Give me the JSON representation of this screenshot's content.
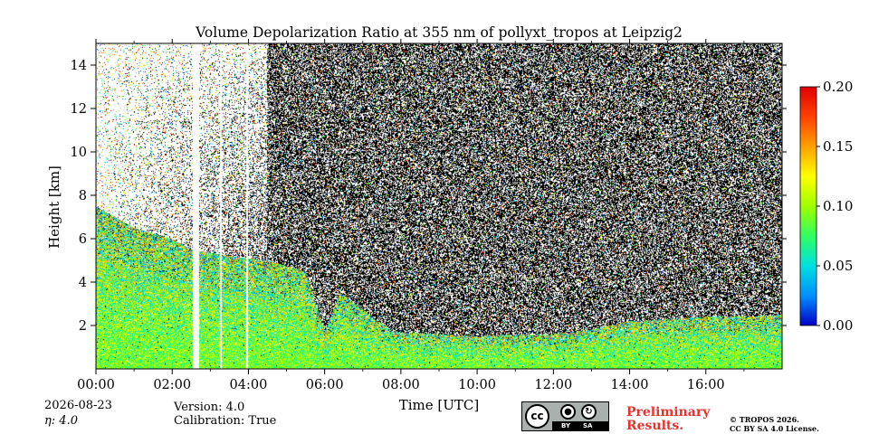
{
  "chart_data": {
    "type": "heatmap",
    "title": "Volume Depolarization Ratio at 355 nm of pollyxt_tropos at Leipzig2",
    "xlabel": "Time [UTC]",
    "ylabel": "Height [km]",
    "xlim": [
      "00:00",
      "18:00"
    ],
    "xlim_hours": [
      0,
      18
    ],
    "ylim": [
      0,
      15
    ],
    "x_ticks": [
      "00:00",
      "02:00",
      "04:00",
      "06:00",
      "08:00",
      "10:00",
      "12:00",
      "14:00",
      "16:00"
    ],
    "y_ticks": [
      2,
      4,
      6,
      8,
      10,
      12,
      14
    ],
    "colorbar": {
      "min": 0.0,
      "max": 0.2,
      "ticks": [
        "0.00",
        "0.05",
        "0.10",
        "0.15",
        "0.20"
      ],
      "colors": [
        "#0000c8",
        "#0090ff",
        "#00e0e0",
        "#30ff60",
        "#a0ff00",
        "#ffff00",
        "#ffa000",
        "#ff4000",
        "#e00000"
      ]
    },
    "features": {
      "near_surface_depolarization": 0.09,
      "boundary_layer_top_km": [
        [
          0.0,
          7.5
        ],
        [
          1.0,
          6.5
        ],
        [
          2.0,
          6.0
        ],
        [
          2.5,
          5.5
        ],
        [
          3.5,
          5.2
        ],
        [
          4.5,
          5.0
        ],
        [
          5.5,
          4.5
        ],
        [
          6.0,
          1.7
        ],
        [
          6.4,
          3.5
        ],
        [
          7.8,
          1.7
        ],
        [
          9.0,
          1.6
        ],
        [
          10.0,
          1.5
        ],
        [
          11.0,
          1.6
        ],
        [
          12.0,
          1.6
        ],
        [
          13.0,
          1.8
        ],
        [
          14.0,
          2.2
        ],
        [
          15.0,
          2.3
        ],
        [
          16.0,
          2.4
        ],
        [
          17.0,
          2.4
        ],
        [
          18.0,
          2.5
        ]
      ],
      "no_data_gaps_hours": [
        [
          2.55,
          2.7
        ],
        [
          3.25,
          3.3
        ],
        [
          3.95,
          4.0
        ]
      ]
    }
  },
  "footer": {
    "date": "2026-08-23",
    "eta": "η: 4.0",
    "version": "Version: 4.0",
    "calibration": "Calibration: True",
    "preliminary": "Preliminary",
    "results": "Results.",
    "copyright": "© TROPOS 2026.",
    "license": "CC BY SA 4.0 License.",
    "cc_badge": {
      "cc": "cc",
      "by": "BY",
      "sa": "SA"
    }
  }
}
